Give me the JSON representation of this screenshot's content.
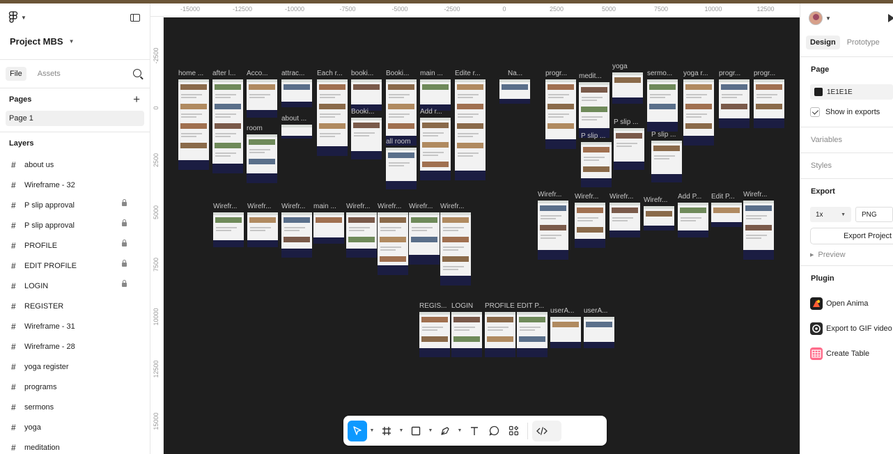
{
  "app": {
    "project_name": "Project MBS"
  },
  "left_panel": {
    "tabs": [
      "File",
      "Assets"
    ],
    "pages_title": "Pages",
    "pages": [
      "Page 1"
    ],
    "layers_title": "Layers",
    "layers": [
      {
        "name": "about us",
        "locked": false
      },
      {
        "name": "Wireframe - 32",
        "locked": false
      },
      {
        "name": "P slip approval",
        "locked": true
      },
      {
        "name": "P slip approval",
        "locked": true
      },
      {
        "name": "PROFILE",
        "locked": true
      },
      {
        "name": "EDIT PROFILE",
        "locked": true
      },
      {
        "name": "LOGIN",
        "locked": true
      },
      {
        "name": "REGISTER",
        "locked": false
      },
      {
        "name": "Wireframe - 31",
        "locked": false
      },
      {
        "name": "Wireframe - 28",
        "locked": false
      },
      {
        "name": "yoga register",
        "locked": false
      },
      {
        "name": "programs",
        "locked": false
      },
      {
        "name": "sermons",
        "locked": false
      },
      {
        "name": "yoga",
        "locked": false
      },
      {
        "name": "meditation",
        "locked": false
      }
    ]
  },
  "rulers": {
    "top": [
      "-15000",
      "-12500",
      "-10000",
      "-7500",
      "-5000",
      "-2500",
      "0",
      "2500",
      "5000",
      "7500",
      "10000",
      "12500"
    ],
    "left": [
      "-2500",
      "0",
      "2500",
      "5000",
      "7500",
      "10000",
      "12500",
      "15000"
    ]
  },
  "canvas": {
    "background": "#1E1E1E",
    "frame_labels": [
      "home ...",
      "after l...",
      "Acco...",
      "attrac...",
      "Each r...",
      "booki...",
      "Booki...",
      "main ...",
      "Edite r...",
      "Na...",
      "progr...",
      "medit...",
      "yoga",
      "sermo...",
      "yoga r...",
      "progr...",
      "progr...",
      "Booki...",
      "Add r...",
      "room",
      "about ...",
      "all room",
      "P slip ...",
      "P slip ...",
      "P slip ...",
      "Wirefr...",
      "Wirefr...",
      "Wirefr...",
      "main ...",
      "Wirefr...",
      "Wirefr...",
      "Wirefr...",
      "Wirefr...",
      "Wirefr...",
      "Wirefr...",
      "Wirefr...",
      "Wirefr...",
      "Add P...",
      "Edit P...",
      "Wirefr...",
      "REGIS...",
      "LOGIN",
      "PROFILE",
      "EDIT P...",
      "userA...",
      "userA..."
    ]
  },
  "toolbar": {
    "tools": [
      "move-tool",
      "frame-tool",
      "shape-tool",
      "pen-tool",
      "text-tool",
      "comment-tool",
      "actions-tool",
      "dev-mode"
    ]
  },
  "right_panel": {
    "tabs": [
      "Design",
      "Prototype"
    ],
    "page_title": "Page",
    "page_color": "1E1E1E",
    "show_in_exports": "Show in exports",
    "variables": "Variables",
    "styles": "Styles",
    "export_title": "Export",
    "export_scale": "1x",
    "export_format": "PNG",
    "export_button": "Export Project",
    "preview": "Preview",
    "plugin_title": "Plugin",
    "plugins": [
      "Open Anima",
      "Export to GIF video",
      "Create Table"
    ]
  }
}
